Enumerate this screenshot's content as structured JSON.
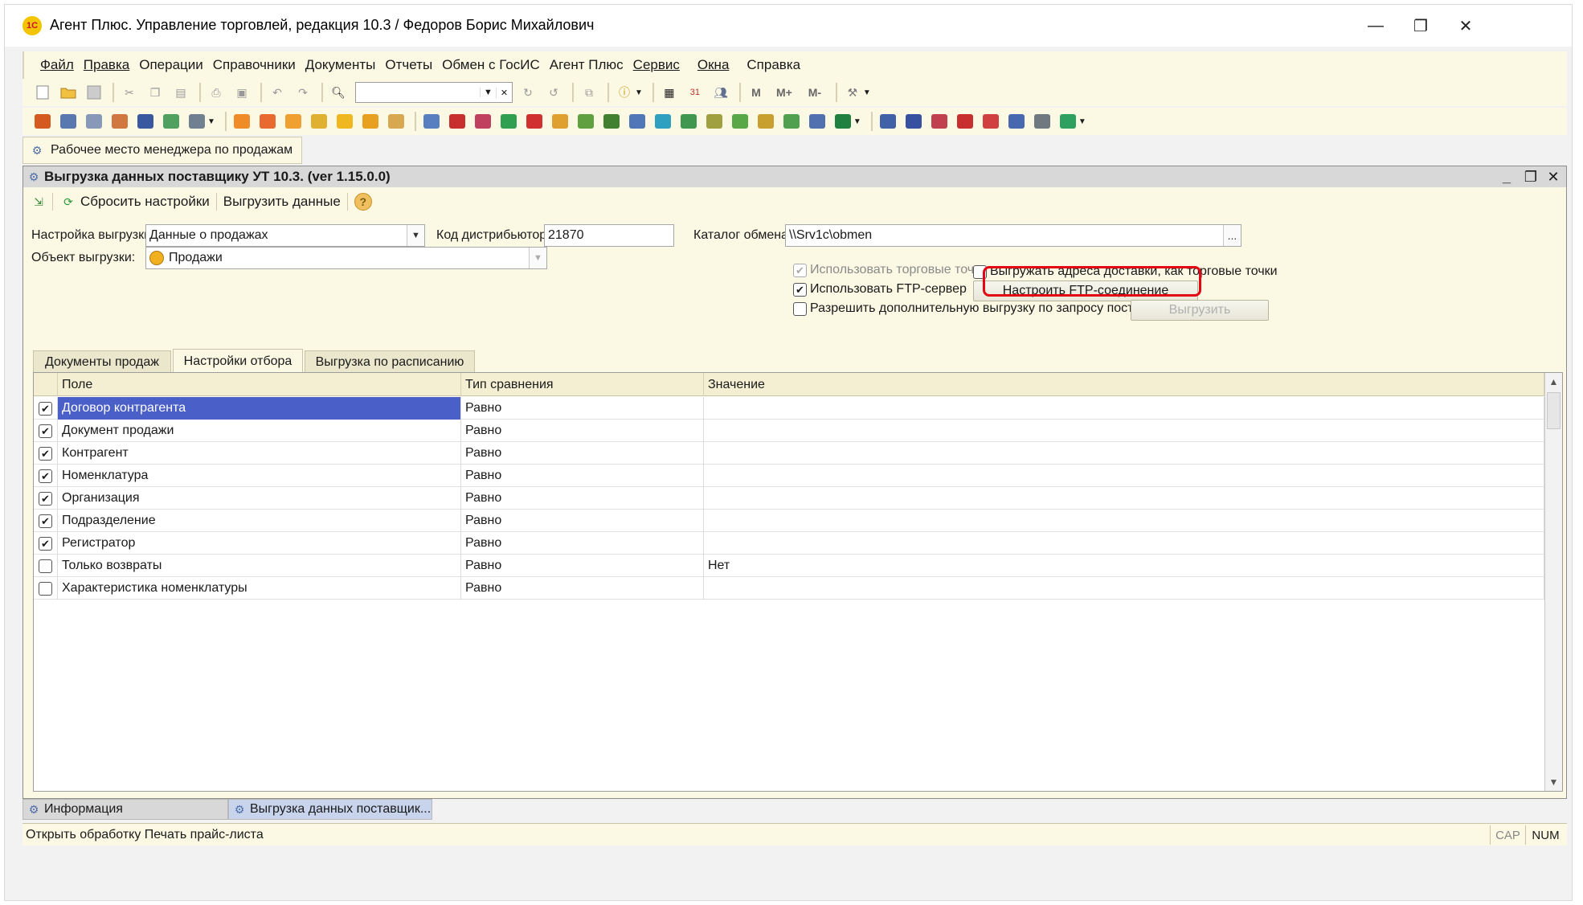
{
  "window": {
    "title": "Агент Плюс. Управление торговлей, редакция 10.3 / Федоров Борис Михайлович",
    "logo_text": "1С",
    "controls": [
      "—",
      "❐",
      "✕"
    ]
  },
  "menu": [
    "Файл",
    "Правка",
    "Операции",
    "Справочники",
    "Документы",
    "Отчеты",
    "Обмен с ГосИС",
    "Агент Плюс",
    "Сервис",
    "Окна",
    "Справка"
  ],
  "open_window_tab": "Рабочее место менеджера по продажам",
  "form": {
    "title": "Выгрузка данных поставщику УТ 10.3. (ver 1.15.0.0)",
    "toolbar": {
      "reset_label": "Сбросить настройки",
      "export_label": "Выгрузить данные",
      "help_label": "?"
    },
    "settings_label": "Настройка выгрузки:",
    "settings_value": "Данные о продажах",
    "distributor_code_label": "Код дистрибьютор..",
    "distributor_code_value": "21870",
    "exchange_catalog_label": "Каталог обмена:",
    "exchange_catalog_value": "\\\\Srv1c\\obmen",
    "browse_label": "...",
    "object_label": "Объект выгрузки:",
    "object_value": "Продажи",
    "use_trade_points": {
      "label": "Использовать торговые точки",
      "checked": true,
      "disabled": true
    },
    "export_delivery_addresses": {
      "label": "Выгружать адреса доставки, как торговые точки",
      "checked": false
    },
    "use_ftp": {
      "label": "Использовать FTP-сервер",
      "checked": true
    },
    "ftp_setup_button": "Настроить FTP-соединение",
    "allow_additional_export": {
      "label": "Разрешить дополнительную выгрузку по запросу поставщика",
      "checked": false
    },
    "export_button": "Выгрузить",
    "tabs": [
      "Документы продаж",
      "Настройки отбора",
      "Выгрузка по расписанию"
    ],
    "active_tab": 1,
    "grid": {
      "columns": [
        "Поле",
        "Тип сравнения",
        "Значение"
      ],
      "rows": [
        {
          "checked": true,
          "field": "Договор контрагента",
          "compare": "Равно",
          "value": ""
        },
        {
          "checked": true,
          "field": "Документ продажи",
          "compare": "Равно",
          "value": ""
        },
        {
          "checked": true,
          "field": "Контрагент",
          "compare": "Равно",
          "value": ""
        },
        {
          "checked": true,
          "field": "Номенклатура",
          "compare": "Равно",
          "value": ""
        },
        {
          "checked": true,
          "field": "Организация",
          "compare": "Равно",
          "value": ""
        },
        {
          "checked": true,
          "field": "Подразделение",
          "compare": "Равно",
          "value": ""
        },
        {
          "checked": true,
          "field": "Регистратор",
          "compare": "Равно",
          "value": ""
        },
        {
          "checked": false,
          "field": "Только возвраты",
          "compare": "Равно",
          "value": "Нет"
        },
        {
          "checked": false,
          "field": "Характеристика номенклатуры",
          "compare": "Равно",
          "value": ""
        }
      ]
    }
  },
  "bottom_tabs": [
    "Информация",
    "Выгрузка данных поставщик..."
  ],
  "status": {
    "text": "Открыть обработку Печать прайс-листа",
    "cap": "CAP",
    "num": "NUM"
  },
  "colors": {
    "highlight": "#e30613",
    "selection": "#4a5fc8",
    "panel": "#fbf8e4"
  }
}
